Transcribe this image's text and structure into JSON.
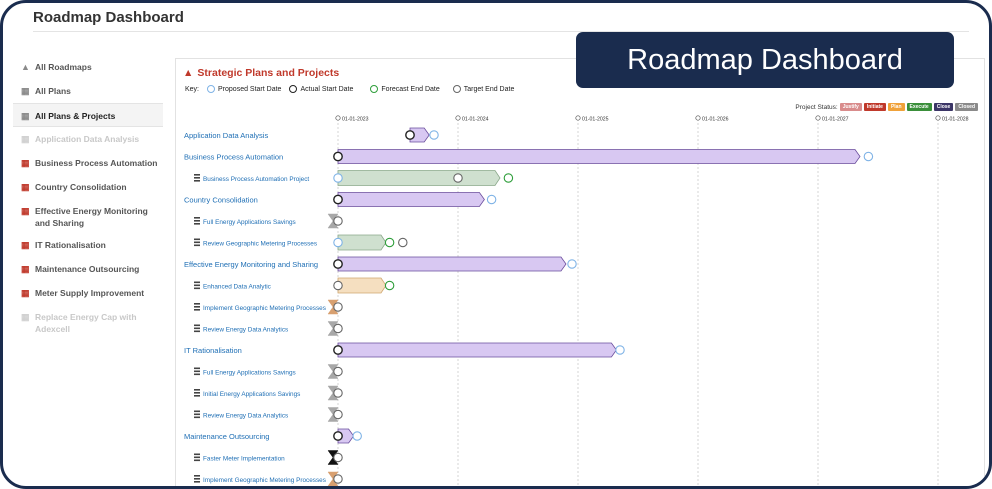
{
  "app": {
    "title": "Roadmap Dashboard"
  },
  "banner": {
    "text": "Roadmap Dashboard"
  },
  "sidebar": {
    "items": [
      {
        "label": "All Roadmaps",
        "icon": "road-icon",
        "state": "nav"
      },
      {
        "label": "All Plans",
        "icon": "calendar-icon",
        "state": "nav"
      },
      {
        "label": "All Plans & Projects",
        "icon": "calendar-icon",
        "state": "active"
      },
      {
        "label": "Application Data Analysis",
        "icon": "calendar-icon",
        "state": "dim"
      },
      {
        "label": "Business Process Automation",
        "icon": "calendar-icon",
        "state": "plan"
      },
      {
        "label": "Country Consolidation",
        "icon": "calendar-icon",
        "state": "plan"
      },
      {
        "label": "Effective Energy Monitoring and Sharing",
        "icon": "calendar-icon",
        "state": "plan"
      },
      {
        "label": "IT Rationalisation",
        "icon": "calendar-icon",
        "state": "plan"
      },
      {
        "label": "Maintenance Outsourcing",
        "icon": "calendar-icon",
        "state": "plan"
      },
      {
        "label": "Meter Supply Improvement",
        "icon": "calendar-icon",
        "state": "plan"
      },
      {
        "label": "Replace Energy Cap with Adexcell",
        "icon": "calendar-icon",
        "state": "dim"
      }
    ]
  },
  "panel": {
    "title": "Strategic Plans and Projects",
    "key_label": "Key:",
    "key": [
      {
        "label": "Proposed Start Date",
        "color": "#7fb3e6"
      },
      {
        "label": "Actual Start Date",
        "color": "#222222"
      },
      {
        "label": "Forecast End Date",
        "color": "#2e9e3a"
      },
      {
        "label": "Target End Date",
        "color": "#666666"
      }
    ],
    "status_label": "Project Status:",
    "statuses": [
      {
        "label": "Justify",
        "color": "#d98c8c"
      },
      {
        "label": "Initiate",
        "color": "#c0392b"
      },
      {
        "label": "Plan",
        "color": "#f0a23a"
      },
      {
        "label": "Execute",
        "color": "#3a8f3a"
      },
      {
        "label": "Close",
        "color": "#3b3566"
      },
      {
        "label": "Closed",
        "color": "#8a8a8a"
      }
    ]
  },
  "timeline": {
    "dates": [
      "01-01-2023",
      "01-01-2024",
      "01-01-2025",
      "01-01-2026",
      "01-01-2027",
      "01-01-2028"
    ],
    "rows": [
      {
        "label": "Application Data Analysis",
        "kind": "plan",
        "bar": {
          "start": 2023.6,
          "end": 2023.76,
          "color": "#d8c8f2",
          "stroke": "#6a4c9c"
        },
        "markers": [
          {
            "at": 2023.6,
            "type": "actual"
          },
          {
            "at": 2023.8,
            "type": "proposed"
          }
        ]
      },
      {
        "label": "Business Process Automation",
        "kind": "plan",
        "bar": {
          "start": 2023.0,
          "end": 2027.35,
          "color": "#d8c8f2",
          "stroke": "#6a4c9c"
        },
        "markers": [
          {
            "at": 2023.0,
            "type": "actual"
          },
          {
            "at": 2027.42,
            "type": "proposed"
          }
        ]
      },
      {
        "label": "Business Process Automation Project",
        "kind": "project",
        "bar": {
          "start": 2023.0,
          "end": 2024.35,
          "color": "#cfe0cf",
          "stroke": "#8aa88a"
        },
        "markers": [
          {
            "at": 2023.0,
            "type": "proposed"
          },
          {
            "at": 2024.0,
            "type": "target"
          },
          {
            "at": 2024.42,
            "type": "forecast"
          }
        ]
      },
      {
        "label": "Country Consolidation",
        "kind": "plan",
        "bar": {
          "start": 2023.0,
          "end": 2024.22,
          "color": "#d8c8f2",
          "stroke": "#6a4c9c"
        },
        "markers": [
          {
            "at": 2023.0,
            "type": "actual"
          },
          {
            "at": 2024.28,
            "type": "proposed"
          }
        ]
      },
      {
        "label": "Full Energy Applications Savings",
        "kind": "project",
        "hourglass": true,
        "markers": [
          {
            "at": 2023.0,
            "type": "target"
          }
        ]
      },
      {
        "label": "Review Geographic Metering Processes",
        "kind": "project",
        "bar": {
          "start": 2023.0,
          "end": 2023.4,
          "color": "#cfe0cf",
          "stroke": "#8aa88a"
        },
        "markers": [
          {
            "at": 2023.0,
            "type": "proposed"
          },
          {
            "at": 2023.43,
            "type": "forecast"
          },
          {
            "at": 2023.54,
            "type": "target"
          }
        ]
      },
      {
        "label": "Effective Energy Monitoring and Sharing",
        "kind": "plan",
        "bar": {
          "start": 2023.0,
          "end": 2024.9,
          "color": "#d8c8f2",
          "stroke": "#6a4c9c"
        },
        "markers": [
          {
            "at": 2023.0,
            "type": "actual"
          },
          {
            "at": 2024.95,
            "type": "proposed"
          }
        ]
      },
      {
        "label": "Enhanced Data Analytic",
        "kind": "project",
        "bar": {
          "start": 2023.0,
          "end": 2023.4,
          "color": "#f5dfc0",
          "stroke": "#d0a870"
        },
        "markers": [
          {
            "at": 2023.0,
            "type": "target"
          },
          {
            "at": 2023.43,
            "type": "forecast"
          }
        ]
      },
      {
        "label": "Implement Geographic Metering Processes",
        "kind": "project",
        "hourglass": true,
        "hourglassColor": "#d8a070",
        "markers": [
          {
            "at": 2023.0,
            "type": "target"
          }
        ]
      },
      {
        "label": "Review Energy Data Analytics",
        "kind": "project",
        "hourglass": true,
        "markers": [
          {
            "at": 2023.0,
            "type": "target"
          }
        ]
      },
      {
        "label": "IT Rationalisation",
        "kind": "plan",
        "bar": {
          "start": 2023.0,
          "end": 2025.32,
          "color": "#d8c8f2",
          "stroke": "#6a4c9c"
        },
        "markers": [
          {
            "at": 2023.0,
            "type": "actual"
          },
          {
            "at": 2025.35,
            "type": "proposed"
          }
        ]
      },
      {
        "label": "Full Energy Applications Savings",
        "kind": "project",
        "hourglass": true,
        "markers": [
          {
            "at": 2023.0,
            "type": "target"
          }
        ]
      },
      {
        "label": "Initial Energy Applications Savings",
        "kind": "project",
        "hourglass": true,
        "markers": [
          {
            "at": 2023.0,
            "type": "target"
          }
        ]
      },
      {
        "label": "Review Energy Data Analytics",
        "kind": "project",
        "hourglass": true,
        "markers": [
          {
            "at": 2023.0,
            "type": "target"
          }
        ]
      },
      {
        "label": "Maintenance Outsourcing",
        "kind": "plan",
        "bar": {
          "start": 2023.0,
          "end": 2023.13,
          "color": "#d8c8f2",
          "stroke": "#6a4c9c"
        },
        "markers": [
          {
            "at": 2023.0,
            "type": "actual"
          },
          {
            "at": 2023.16,
            "type": "proposed"
          }
        ]
      },
      {
        "label": "Faster Meter Implementation",
        "kind": "project",
        "hourglass": true,
        "hourglassColor": "#111111",
        "markers": [
          {
            "at": 2023.0,
            "type": "target"
          }
        ]
      },
      {
        "label": "Implement Geographic Metering Processes",
        "kind": "project",
        "hourglass": true,
        "hourglassColor": "#d8a070",
        "markers": [
          {
            "at": 2023.0,
            "type": "target"
          }
        ]
      }
    ]
  }
}
